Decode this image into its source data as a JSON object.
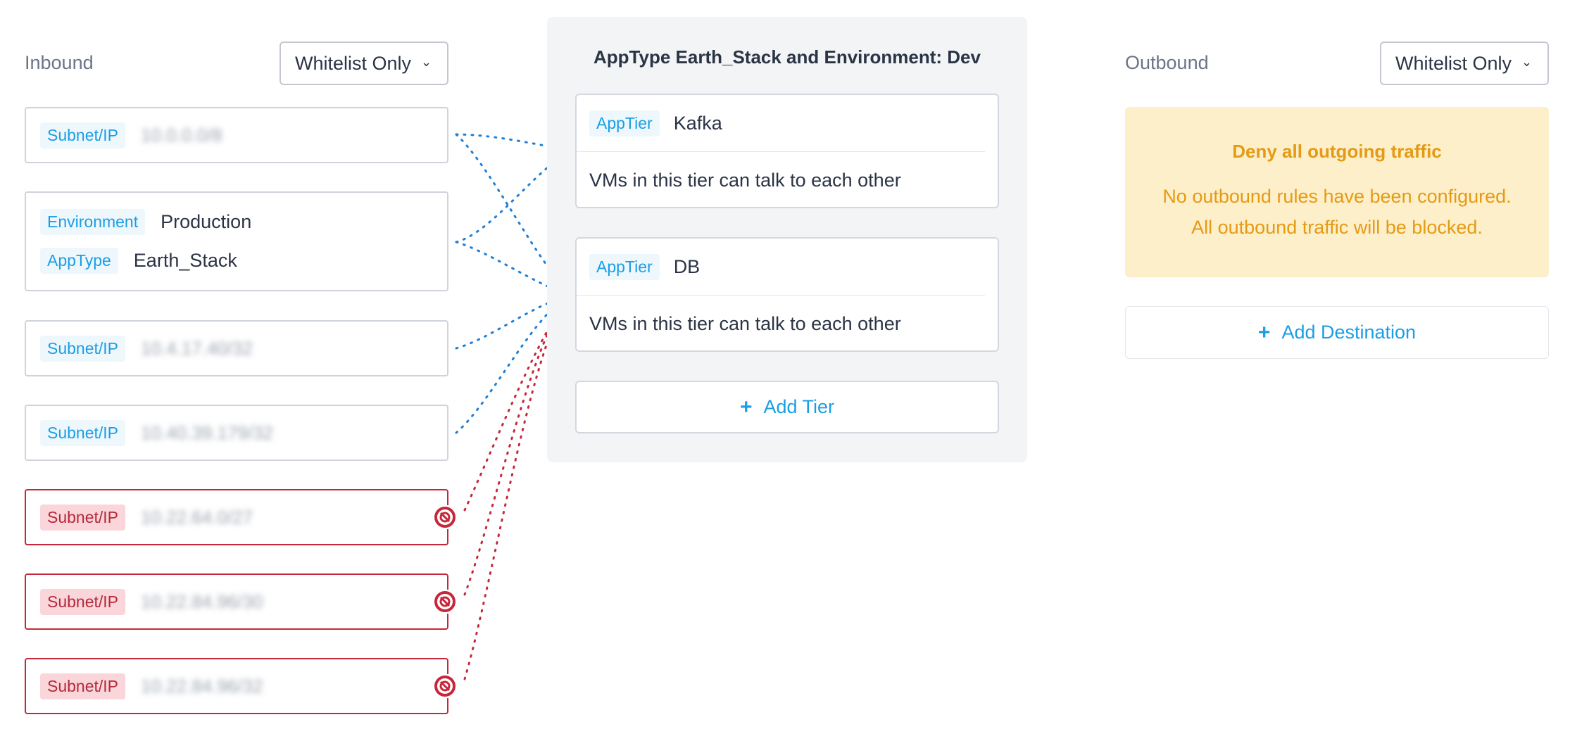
{
  "inbound": {
    "label": "Inbound",
    "dropdown": "Whitelist Only",
    "sources": [
      {
        "type": "subnet",
        "tag": "Subnet/IP",
        "value": "10.0.0.0/8",
        "blocked": false
      },
      {
        "type": "category",
        "rows": [
          {
            "tag": "Environment",
            "value": "Production"
          },
          {
            "tag": "AppType",
            "value": "Earth_Stack"
          }
        ],
        "blocked": false
      },
      {
        "type": "subnet",
        "tag": "Subnet/IP",
        "value": "10.4.17.40/32",
        "blocked": false
      },
      {
        "type": "subnet",
        "tag": "Subnet/IP",
        "value": "10.40.39.179/32",
        "blocked": false
      },
      {
        "type": "subnet",
        "tag": "Subnet/IP",
        "value": "10.22.64.0/27",
        "blocked": true
      },
      {
        "type": "subnet",
        "tag": "Subnet/IP",
        "value": "10.22.84.96/30",
        "blocked": true
      },
      {
        "type": "subnet",
        "tag": "Subnet/IP",
        "value": "10.22.84.96/32",
        "blocked": true
      }
    ]
  },
  "center": {
    "title": "AppType Earth_Stack and Environment: Dev",
    "tiers": [
      {
        "tag": "AppTier",
        "name": "Kafka",
        "description": "VMs in this tier can talk to each other"
      },
      {
        "tag": "AppTier",
        "name": "DB",
        "description": "VMs in this tier can talk to each other"
      }
    ],
    "add_tier": "Add Tier"
  },
  "outbound": {
    "label": "Outbound",
    "dropdown": "Whitelist Only",
    "deny_title": "Deny all outgoing traffic",
    "deny_line1": "No outbound rules have been configured.",
    "deny_line2": "All outbound traffic will be blocked.",
    "add_destination": "Add Destination"
  },
  "icons": {
    "dropdown": "chevron-down-icon",
    "add": "plus-icon",
    "blocked": "block-icon"
  },
  "colors": {
    "allowed_link": "#1f7fd6",
    "blocked_link": "#c6283b",
    "accent": "#1a9ee4",
    "warning_text": "#e59a14",
    "warning_bg": "#fdefc9"
  }
}
